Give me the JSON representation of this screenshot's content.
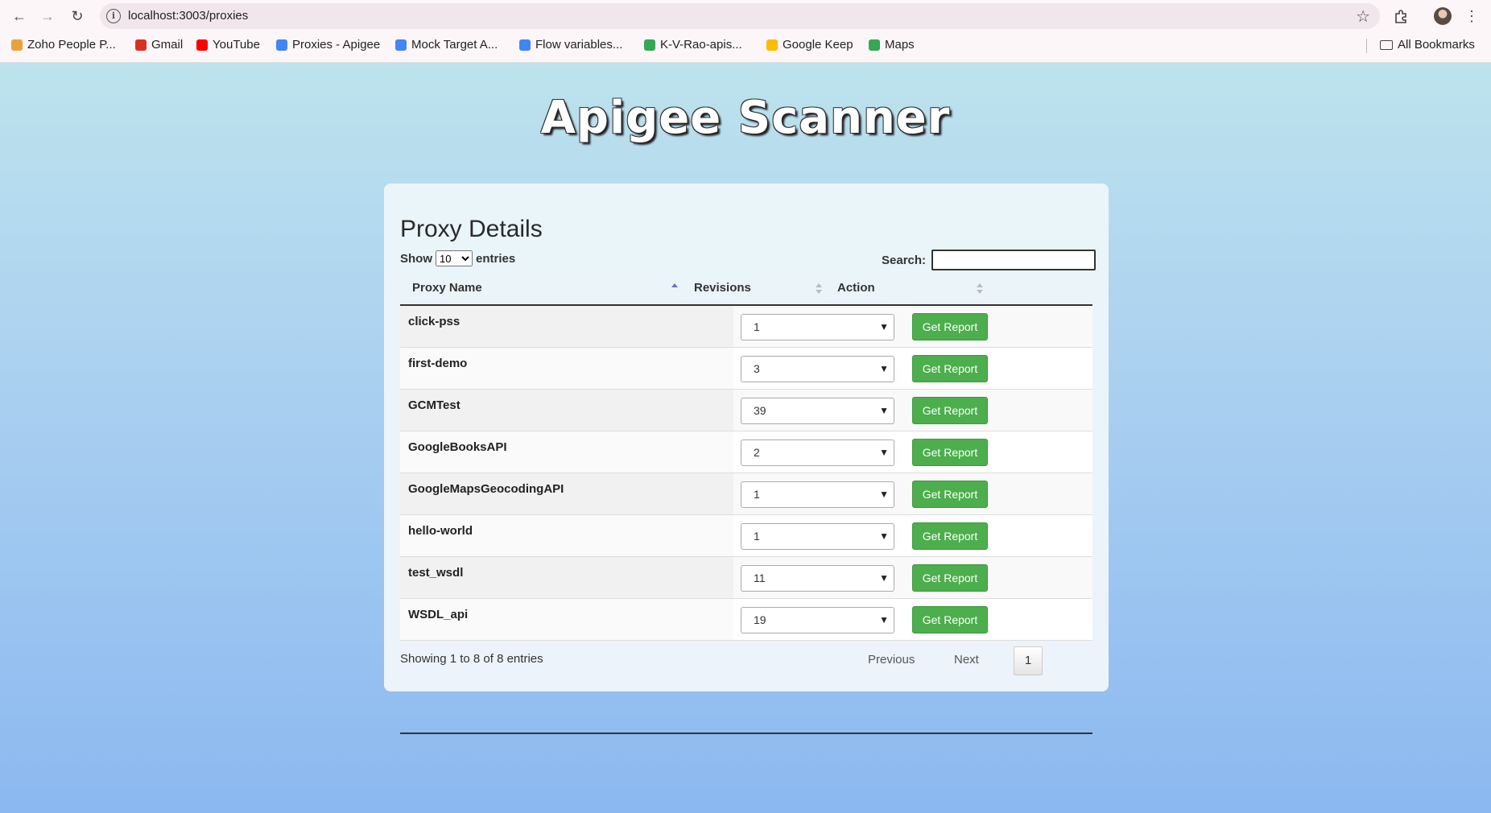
{
  "browser": {
    "url": "localhost:3003/proxies",
    "bookmarks": [
      {
        "label": "Zoho People P...",
        "icon": "zoho-icon",
        "color": "#e8a23a"
      },
      {
        "label": "Gmail",
        "icon": "gmail-icon",
        "color": "#d93025"
      },
      {
        "label": "YouTube",
        "icon": "youtube-icon",
        "color": "#ff0000"
      },
      {
        "label": "Proxies - Apigee",
        "icon": "apigee-icon",
        "color": "#4285f4"
      },
      {
        "label": "Mock Target A...",
        "icon": "gcloud-icon",
        "color": "#4285f4"
      },
      {
        "label": "Flow variables...",
        "icon": "gcloud-icon",
        "color": "#4285f4"
      },
      {
        "label": "K-V-Rao-apis...",
        "icon": "page-icon",
        "color": "#34a853"
      },
      {
        "label": "Google Keep",
        "icon": "keep-icon",
        "color": "#fbbc04"
      },
      {
        "label": "Maps",
        "icon": "maps-icon",
        "color": "#34a853"
      }
    ],
    "all_bookmarks": "All Bookmarks"
  },
  "header": {
    "title": "Apigee Scanner"
  },
  "card": {
    "title": "Proxy Details",
    "show_label": "Show",
    "entries_value": "10",
    "entries_label": "entries",
    "search_label": "Search:",
    "search_value": ""
  },
  "table": {
    "columns": [
      "Proxy Name",
      "Revisions",
      "Action"
    ],
    "rows": [
      {
        "name": "click-pss",
        "revision": "1",
        "action": "Get Report"
      },
      {
        "name": "first-demo",
        "revision": "3",
        "action": "Get Report"
      },
      {
        "name": "GCMTest",
        "revision": "39",
        "action": "Get Report"
      },
      {
        "name": "GoogleBooksAPI",
        "revision": "2",
        "action": "Get Report"
      },
      {
        "name": "GoogleMapsGeocodingAPI",
        "revision": "1",
        "action": "Get Report"
      },
      {
        "name": "hello-world",
        "revision": "1",
        "action": "Get Report"
      },
      {
        "name": "test_wsdl",
        "revision": "11",
        "action": "Get Report"
      },
      {
        "name": "WSDL_api",
        "revision": "19",
        "action": "Get Report"
      }
    ]
  },
  "footer": {
    "info": "Showing 1 to 8 of 8 entries",
    "previous": "Previous",
    "page": "1",
    "next": "Next"
  }
}
